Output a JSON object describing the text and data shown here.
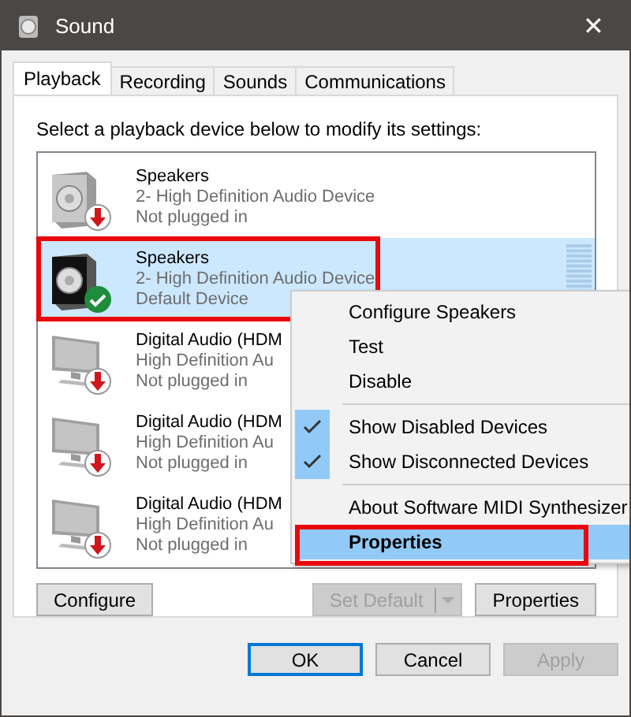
{
  "window": {
    "title": "Sound",
    "close": "✕"
  },
  "tabs": [
    {
      "label": "Playback",
      "selected": true
    },
    {
      "label": "Recording",
      "selected": false
    },
    {
      "label": "Sounds",
      "selected": false
    },
    {
      "label": "Communications",
      "selected": false
    }
  ],
  "instruction": "Select a playback device below to modify its settings:",
  "devices": [
    {
      "kind": "speaker",
      "default": false,
      "name": "Speakers",
      "description": "2- High Definition Audio Device",
      "status": "Not plugged in",
      "selected": false,
      "annotated": false
    },
    {
      "kind": "speaker",
      "default": true,
      "name": "Speakers",
      "description": "2- High Definition Audio Device",
      "status": "Default Device",
      "selected": true,
      "annotated": true
    },
    {
      "kind": "monitor",
      "default": false,
      "name": "Digital Audio (HDM",
      "description": "High Definition Au",
      "status": "Not plugged in",
      "selected": false,
      "annotated": false
    },
    {
      "kind": "monitor",
      "default": false,
      "name": "Digital Audio (HDM",
      "description": "High Definition Au",
      "status": "Not plugged in",
      "selected": false,
      "annotated": false
    },
    {
      "kind": "monitor",
      "default": false,
      "name": "Digital Audio (HDM",
      "description": "High Definition Au",
      "status": "Not plugged in",
      "selected": false,
      "annotated": false
    }
  ],
  "context_menu": [
    {
      "kind": "item",
      "label": "Configure Speakers",
      "checked": false,
      "selected": false,
      "annotated": false
    },
    {
      "kind": "item",
      "label": "Test",
      "checked": false,
      "selected": false,
      "annotated": false
    },
    {
      "kind": "item",
      "label": "Disable",
      "checked": false,
      "selected": false,
      "annotated": false
    },
    {
      "kind": "separator"
    },
    {
      "kind": "item",
      "label": "Show Disabled Devices",
      "checked": true,
      "selected": false,
      "annotated": false
    },
    {
      "kind": "item",
      "label": "Show Disconnected Devices",
      "checked": true,
      "selected": false,
      "annotated": false
    },
    {
      "kind": "separator"
    },
    {
      "kind": "item",
      "label": "About Software MIDI Synthesizer",
      "checked": false,
      "selected": false,
      "annotated": false
    },
    {
      "kind": "item",
      "label": "Properties",
      "checked": false,
      "selected": true,
      "annotated": true
    }
  ],
  "panel_buttons": {
    "configure": {
      "label": "Configure",
      "disabled": false
    },
    "set_default": {
      "label": "Set Default",
      "disabled": true
    },
    "properties": {
      "label": "Properties",
      "disabled": false
    }
  },
  "dialog_buttons": [
    {
      "label": "OK",
      "disabled": false,
      "default": true
    },
    {
      "label": "Cancel",
      "disabled": false,
      "default": false
    },
    {
      "label": "Apply",
      "disabled": true,
      "default": false
    }
  ]
}
